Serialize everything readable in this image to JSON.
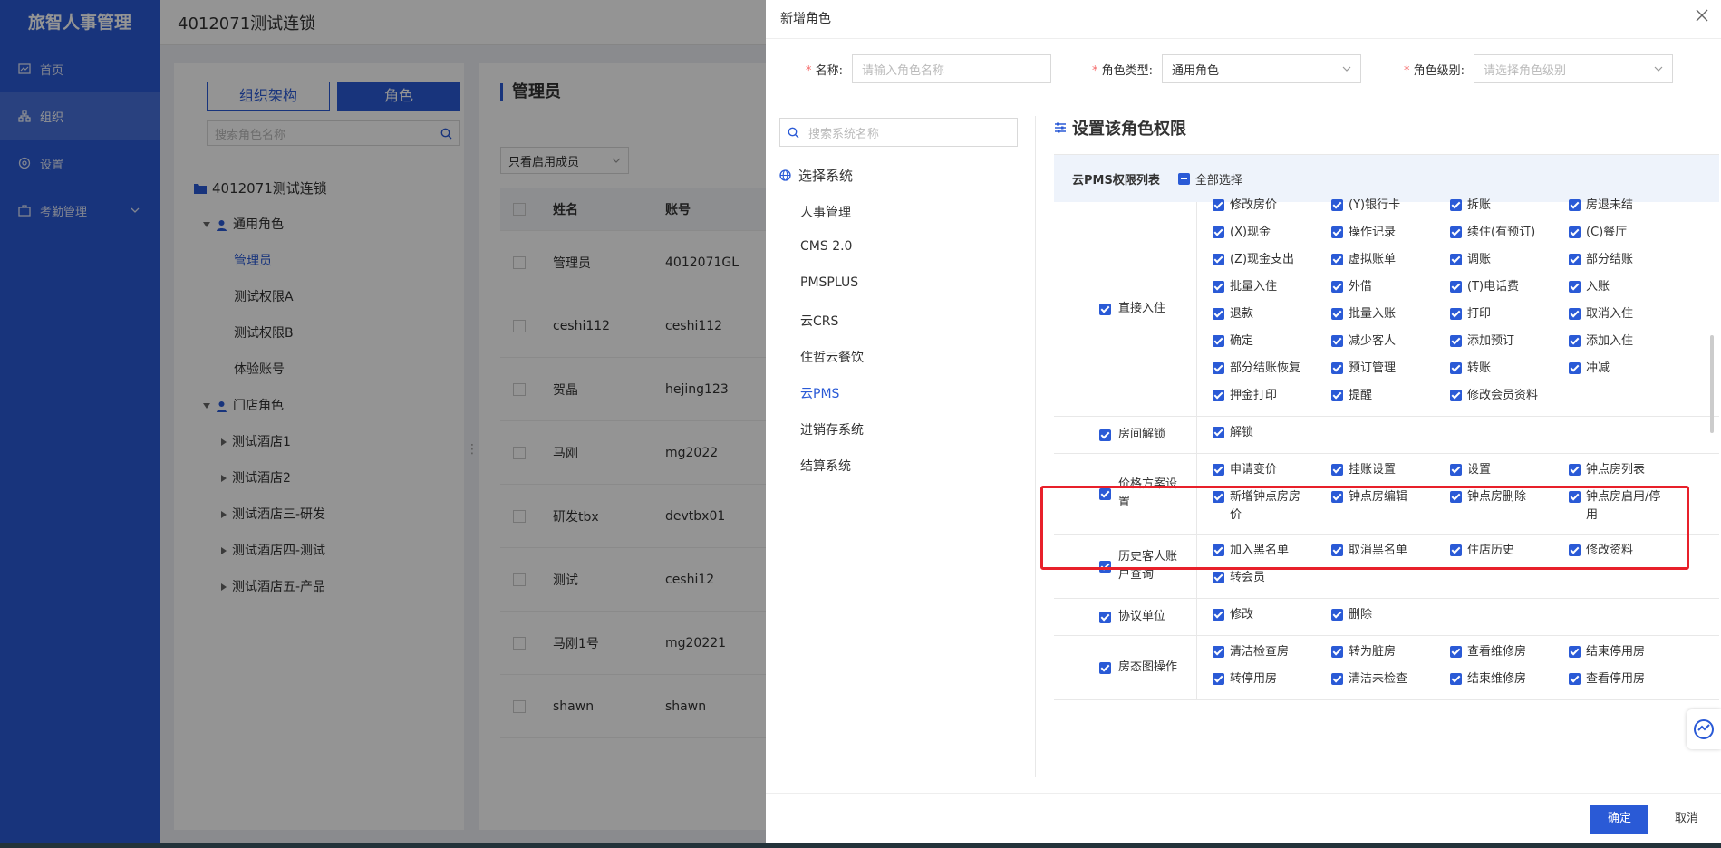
{
  "nav": {
    "brand": "旅智人事管理",
    "items": [
      {
        "label": "首页",
        "icon": "dashboard-icon"
      },
      {
        "label": "组织",
        "icon": "org-icon",
        "active": true
      },
      {
        "label": "设置",
        "icon": "gear-icon"
      },
      {
        "label": "考勤管理",
        "icon": "briefcase-icon"
      }
    ]
  },
  "topbar": {
    "title": "4012071测试连锁"
  },
  "tree": {
    "tab_org": "组织架构",
    "tab_role": "角色",
    "search_placeholder": "搜索角色名称",
    "root": "4012071测试连锁",
    "groups": [
      {
        "label": "通用角色",
        "children": [
          "管理员",
          "测试权限A",
          "测试权限B",
          "体验账号"
        ]
      },
      {
        "label": "门店角色",
        "children": [
          "测试酒店1",
          "测试酒店2",
          "测试酒店三-研发",
          "测试酒店四-测试",
          "测试酒店五-产品"
        ]
      }
    ],
    "active_child": "管理员"
  },
  "members": {
    "title": "管理员",
    "filter": "只看启用成员",
    "columns": [
      "姓名",
      "账号"
    ],
    "rows": [
      [
        "管理员",
        "4012071GL"
      ],
      [
        "ceshi112",
        "ceshi112"
      ],
      [
        "贺晶",
        "hejing123"
      ],
      [
        "马刚",
        "mg2022"
      ],
      [
        "研发tbx",
        "devtbx01"
      ],
      [
        "测试",
        "ceshi12"
      ],
      [
        "马刚1号",
        "mg20221"
      ],
      [
        "shawn",
        "shawn"
      ]
    ]
  },
  "drawer": {
    "title": "新增角色",
    "name_label": "名称:",
    "name_placeholder": "请输入角色名称",
    "type_label": "角色类型:",
    "type_value": "通用角色",
    "level_label": "角色级别:",
    "level_placeholder": "请选择角色级别",
    "sys_search_placeholder": "搜索系统名称",
    "sys_header": "选择系统",
    "systems": [
      "人事管理",
      "CMS 2.0",
      "PMSPLUS",
      "云CRS",
      "住哲云餐饮",
      "云PMS",
      "进销存系统",
      "结算系统"
    ],
    "active_system": "云PMS",
    "perm_title": "设置该角色权限",
    "perm_list_title": "云PMS权限列表",
    "select_all": "全部选择",
    "perm_rows": [
      {
        "cat": "直接入住",
        "items": [
          "修改房价",
          "(Y)银行卡",
          "拆账",
          "房退未结",
          "(X)现金",
          "操作记录",
          "续住(有预订)",
          "(C)餐厅",
          "(Z)现金支出",
          "虚拟账单",
          "调账",
          "部分结账",
          "批量入住",
          "外借",
          "(T)电话费",
          "入账",
          "退款",
          "批量入账",
          "打印",
          "取消入住",
          "确定",
          "减少客人",
          "添加预订",
          "添加入住",
          "部分结账恢复",
          "预订管理",
          "转账",
          "冲减",
          "押金打印",
          "提醒",
          "修改会员资料"
        ]
      },
      {
        "cat": "房间解锁",
        "items": [
          "解锁"
        ]
      },
      {
        "cat": "价格方案设置",
        "items": [
          "申请变价",
          "挂账设置",
          "设置",
          "钟点房列表",
          "新增钟点房房价",
          "钟点房编辑",
          "钟点房删除",
          "钟点房启用/停用"
        ]
      },
      {
        "cat": "历史客人账户查询",
        "items": [
          "加入黑名单",
          "取消黑名单",
          "住店历史",
          "修改资料",
          "转会员"
        ]
      },
      {
        "cat": "协议单位",
        "items": [
          "修改",
          "删除"
        ]
      },
      {
        "cat": "房态图操作",
        "items": [
          "清洁检查房",
          "转为脏房",
          "查看维修房",
          "结束停用房",
          "转停用房",
          "清洁未检查",
          "结束维修房",
          "查看停用房"
        ]
      }
    ],
    "ok": "确定",
    "cancel": "取消"
  },
  "colors": {
    "primary": "#2a5ad6",
    "highlight": "#e8202a"
  }
}
